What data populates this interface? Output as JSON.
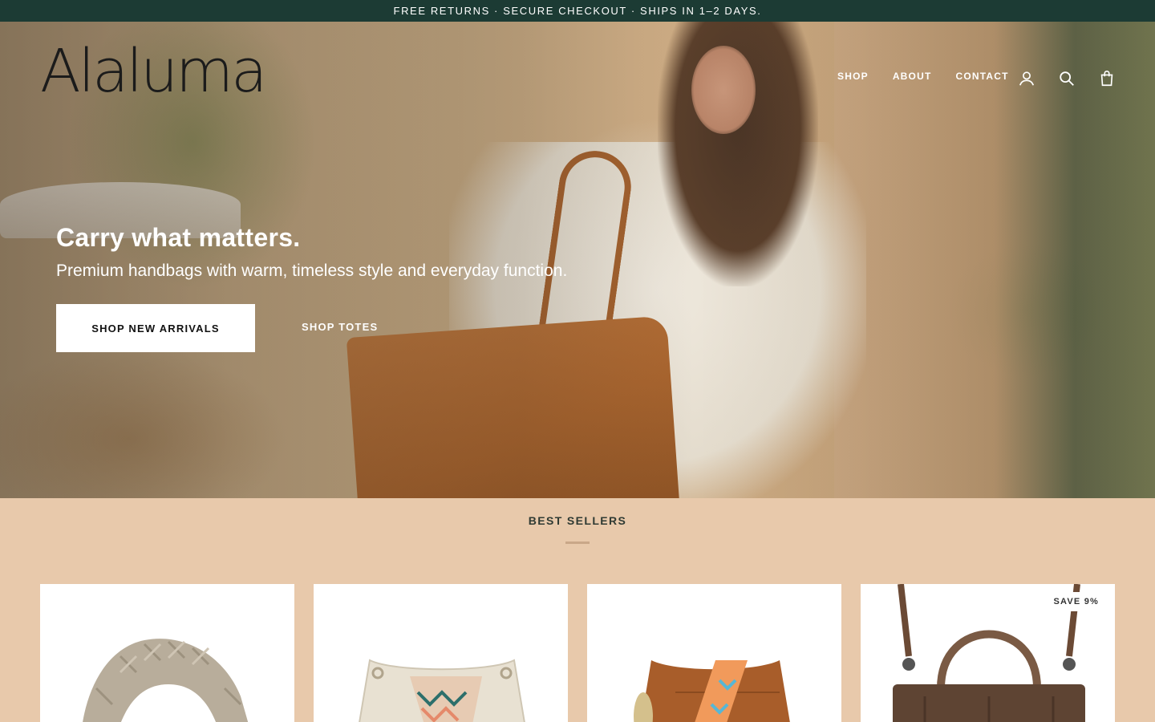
{
  "announcement": "FREE RETURNS · SECURE CHECKOUT · SHIPS IN 1–2 DAYS.",
  "brand": {
    "logo_text": "Alaluma"
  },
  "nav": {
    "items": [
      "SHOP",
      "ABOUT",
      "CONTACT"
    ]
  },
  "header_icons": [
    "account-icon",
    "search-icon",
    "cart-icon"
  ],
  "hero": {
    "title": "Carry what matters.",
    "subtitle": "Premium handbags with warm, timeless style and everyday function.",
    "primary_cta": "SHOP NEW ARRIVALS",
    "secondary_cta": "SHOP TOTES"
  },
  "best_sellers": {
    "title": "BEST SELLERS",
    "products": [
      {
        "badge": ""
      },
      {
        "badge": ""
      },
      {
        "badge": ""
      },
      {
        "badge": "SAVE 9%"
      }
    ]
  },
  "colors": {
    "announcement_bg": "#1c3b34",
    "section_bg": "#e8c9ab",
    "accent_rule": "#c9a788"
  }
}
